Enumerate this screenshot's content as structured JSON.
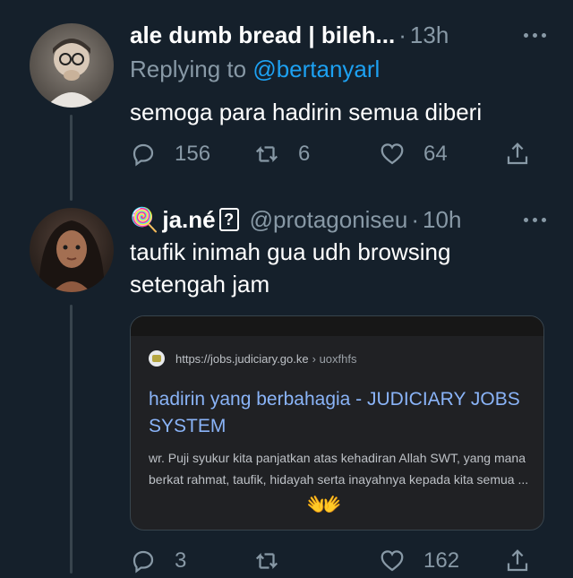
{
  "tweet1": {
    "display_name": "ale dumb bread | bileh...",
    "time": "13h",
    "replying_prefix": "Replying to ",
    "replying_handle": "@bertanyarl",
    "text": "semoga para hadirin semua diberi",
    "reply_count": "156",
    "retweet_count": "6",
    "like_count": "64"
  },
  "tweet2": {
    "name_emoji": "🍭",
    "display_name": "ja.né",
    "unknown_glyph": "?",
    "handle": "@protagoniseu",
    "time": "10h",
    "text": "taufik inimah gua udh browsing setengah jam",
    "reply_count": "3",
    "retweet_count": "",
    "like_count": "162"
  },
  "card": {
    "url": "https://jobs.judiciary.go.ke",
    "breadcrumb": "› uoxfhfs",
    "title": "hadirin yang berbahagia - JUDICIARY JOBS SYSTEM",
    "snippet": "wr. Puji syukur kita panjatkan atas kehadiran Allah SWT, yang mana berkat rahmat, taufik, hidayah serta inayahnya kepada kita semua ...",
    "emoji": "👐"
  },
  "icons": {
    "reply": "reply-icon",
    "retweet": "retweet-icon",
    "like": "heart-icon",
    "share": "share-icon",
    "more": "more-dots-icon"
  },
  "colors": {
    "background": "#15202b",
    "secondary_text": "#8899a6",
    "link": "#1da1f2",
    "card_link": "#8ab4f8"
  }
}
